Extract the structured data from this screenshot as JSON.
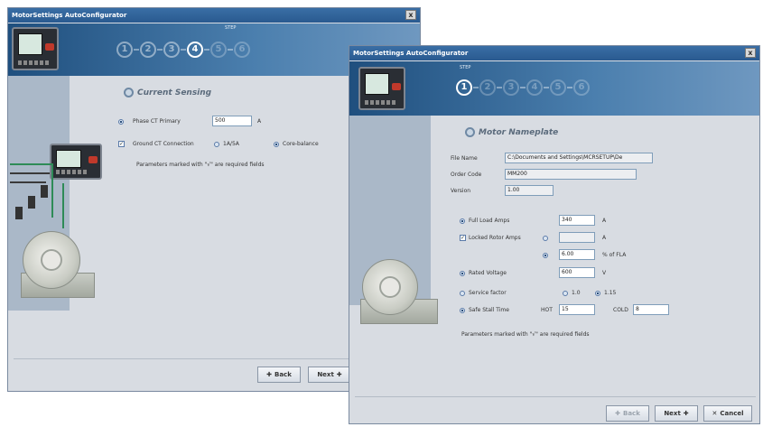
{
  "back_window": {
    "title": "MotorSettings AutoConfigurator",
    "close_glyph": "x",
    "step_label": "STEP",
    "steps": [
      "1",
      "2",
      "3",
      "4",
      "5",
      "6"
    ],
    "active_step": 4,
    "section_title": "Current Sensing",
    "phase_ct_label": "Phase CT Primary",
    "phase_ct_value": "500",
    "phase_ct_unit": "A",
    "ground_ct_label": "Ground CT Connection",
    "ground_opt1": "1A/5A",
    "ground_opt2": "Core-balance",
    "note": "Parameters marked with \"√\" are required fields",
    "back_label": "Back",
    "next_label": "Next"
  },
  "front_window": {
    "title": "MotorSettings AutoConfigurator",
    "close_glyph": "x",
    "step_label": "STEP",
    "steps": [
      "1",
      "2",
      "3",
      "4",
      "5",
      "6"
    ],
    "active_step": 1,
    "section_title": "Motor Nameplate",
    "file_name_label": "File Name",
    "file_name_value": "C:\\Documents and Settings\\MCRSETUP\\De",
    "order_code_label": "Order Code",
    "order_code_value": "MM200",
    "version_label": "Version",
    "version_value": "1.00",
    "fla_label": "Full Load Amps",
    "fla_value": "340",
    "fla_unit": "A",
    "lra_label": "Locked Rotor Amps",
    "lra_value": "",
    "lra_unit": "A",
    "lra_pct_value": "6.00",
    "lra_pct_unit": "% of FLA",
    "rated_voltage_label": "Rated Voltage",
    "rated_voltage_value": "600",
    "rated_voltage_unit": "V",
    "service_factor_label": "Service factor",
    "sf_opt1": "1.0",
    "sf_opt2": "1.15",
    "safe_stall_label": "Safe Stall Time",
    "hot_label": "HOT",
    "hot_value": "15",
    "cold_label": "COLD",
    "cold_value": "8",
    "note": "Parameters marked with \"√\" are required fields",
    "back_label": "Back",
    "next_label": "Next",
    "cancel_label": "Cancel"
  }
}
